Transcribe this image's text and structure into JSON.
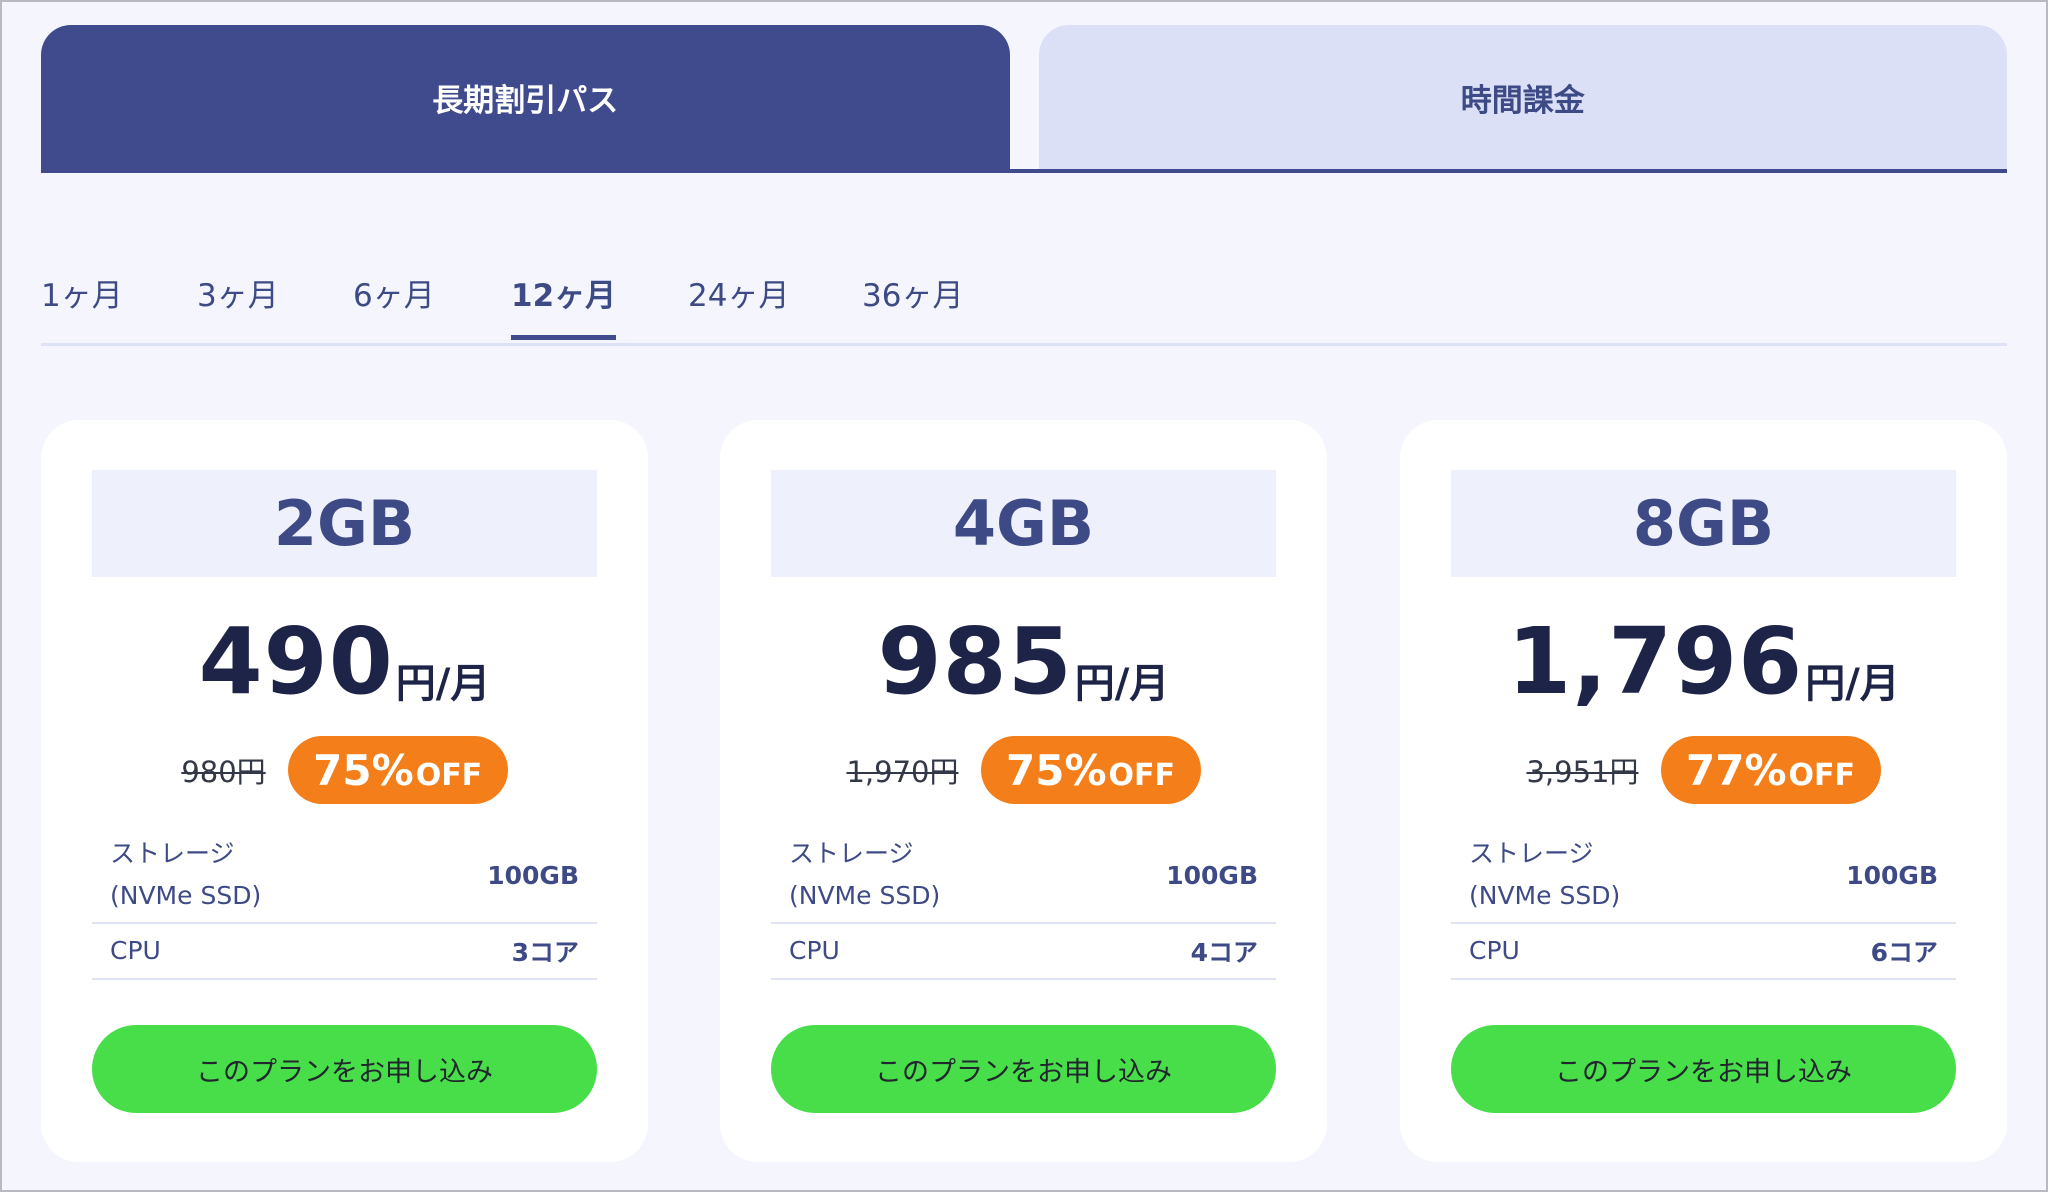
{
  "main_tabs": [
    {
      "label": "長期割引パス",
      "active": true
    },
    {
      "label": "時間課金",
      "active": false
    }
  ],
  "period_tabs": [
    {
      "label": "1ヶ月",
      "active": false
    },
    {
      "label": "3ヶ月",
      "active": false
    },
    {
      "label": "6ヶ月",
      "active": false
    },
    {
      "label": "12ヶ月",
      "active": true
    },
    {
      "label": "24ヶ月",
      "active": false
    },
    {
      "label": "36ヶ月",
      "active": false
    }
  ],
  "plans": [
    {
      "name": "2GB",
      "price": "490",
      "price_unit": "円/月",
      "original_price": "980円",
      "discount_pct": "75%",
      "discount_suffix": "OFF",
      "storage_label_1": "ストレージ",
      "storage_label_2": "(NVMe SSD)",
      "storage_value": "100GB",
      "cpu_label": "CPU",
      "cpu_value": "3コア",
      "button_label": "このプランをお申し込み"
    },
    {
      "name": "4GB",
      "price": "985",
      "price_unit": "円/月",
      "original_price": "1,970円",
      "discount_pct": "75%",
      "discount_suffix": "OFF",
      "storage_label_1": "ストレージ",
      "storage_label_2": "(NVMe SSD)",
      "storage_value": "100GB",
      "cpu_label": "CPU",
      "cpu_value": "4コア",
      "button_label": "このプランをお申し込み"
    },
    {
      "name": "8GB",
      "price": "1,796",
      "price_unit": "円/月",
      "original_price": "3,951円",
      "discount_pct": "77%",
      "discount_suffix": "OFF",
      "storage_label_1": "ストレージ",
      "storage_label_2": "(NVMe SSD)",
      "storage_value": "100GB",
      "cpu_label": "CPU",
      "cpu_value": "6コア",
      "button_label": "このプランをお申し込み"
    }
  ],
  "colors": {
    "primary": "#3f4b8c",
    "tab_inactive": "#dbe0f6",
    "background": "#f5f6fd",
    "discount_badge": "#f47f1a",
    "apply_button": "#47de4a"
  }
}
